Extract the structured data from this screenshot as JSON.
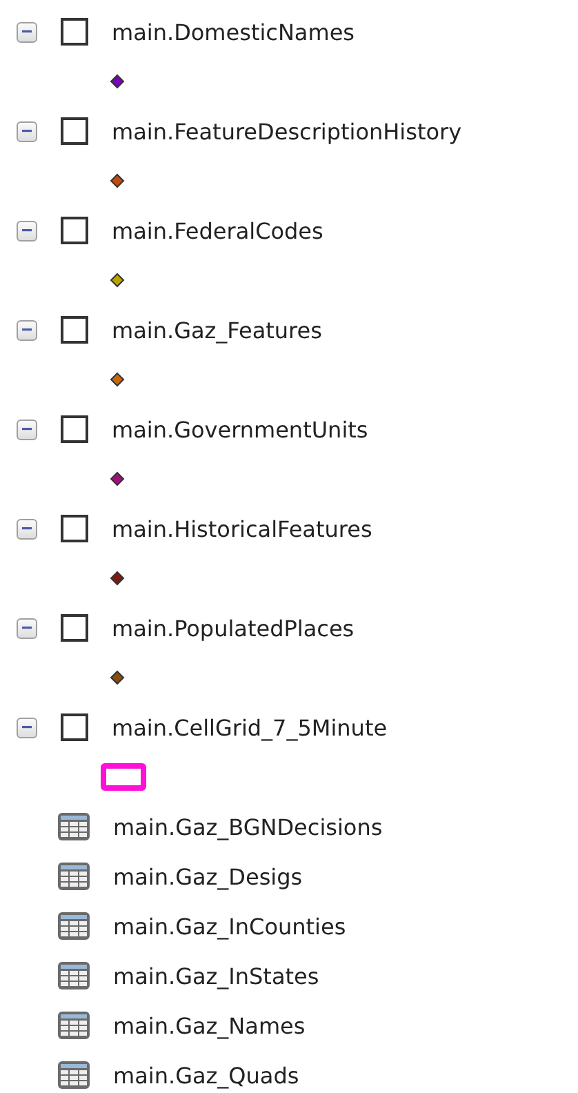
{
  "layers": [
    {
      "name": "main.DomesticNames",
      "expanded": true,
      "checked": false,
      "symbol": {
        "kind": "point",
        "color": "#7b00c0"
      }
    },
    {
      "name": "main.FeatureDescriptionHistory",
      "expanded": true,
      "checked": false,
      "symbol": {
        "kind": "point",
        "color": "#c04a10"
      }
    },
    {
      "name": "main.FederalCodes",
      "expanded": true,
      "checked": false,
      "symbol": {
        "kind": "point",
        "color": "#b8a400"
      }
    },
    {
      "name": "main.Gaz_Features",
      "expanded": true,
      "checked": false,
      "symbol": {
        "kind": "point",
        "color": "#c8680c"
      }
    },
    {
      "name": "main.GovernmentUnits",
      "expanded": true,
      "checked": false,
      "symbol": {
        "kind": "point",
        "color": "#a0107a"
      }
    },
    {
      "name": "main.HistoricalFeatures",
      "expanded": true,
      "checked": false,
      "symbol": {
        "kind": "point",
        "color": "#7a1a10"
      }
    },
    {
      "name": "main.PopulatedPlaces",
      "expanded": true,
      "checked": false,
      "symbol": {
        "kind": "point",
        "color": "#8a4a10"
      }
    },
    {
      "name": "main.CellGrid_7_5Minute",
      "expanded": true,
      "checked": false,
      "symbol": {
        "kind": "polygon",
        "color": "#ff10d8"
      }
    }
  ],
  "tables": [
    {
      "name": "main.Gaz_BGNDecisions"
    },
    {
      "name": "main.Gaz_Desigs"
    },
    {
      "name": "main.Gaz_InCounties"
    },
    {
      "name": "main.Gaz_InStates"
    },
    {
      "name": "main.Gaz_Names"
    },
    {
      "name": "main.Gaz_Quads"
    }
  ]
}
